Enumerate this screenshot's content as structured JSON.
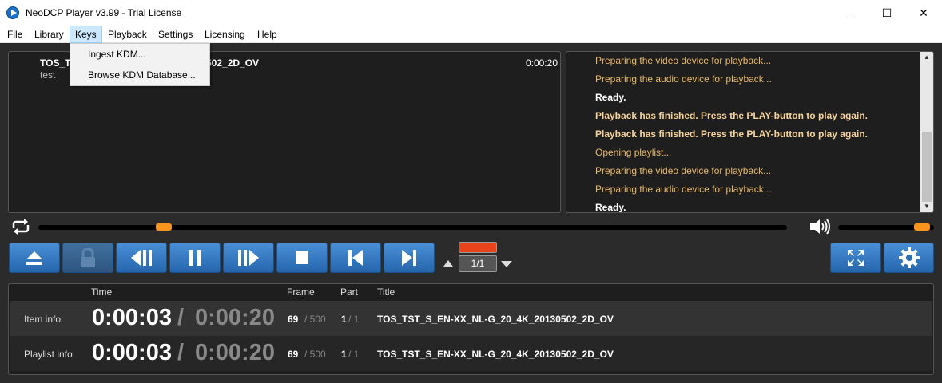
{
  "window": {
    "title": "NeoDCP Player v3.99 - Trial License",
    "minimize": "—",
    "maximize": "☐",
    "close": "✕"
  },
  "menu": {
    "items": [
      "File",
      "Library",
      "Keys",
      "Playback",
      "Settings",
      "Licensing",
      "Help"
    ],
    "active": "Keys"
  },
  "keys_menu": {
    "items": [
      "Ingest KDM...",
      "Browse KDM Database..."
    ]
  },
  "playlist": {
    "item_title_left": "TOS_TS",
    "item_title_right": "502_2D_OV",
    "item_subtitle": "test",
    "item_duration": "0:00:20"
  },
  "log": {
    "lines": [
      {
        "text": "Preparing the video device for playback...",
        "style": "normal"
      },
      {
        "text": "Preparing the audio device for playback...",
        "style": "normal"
      },
      {
        "text": "Ready.",
        "style": "ready"
      },
      {
        "text": "Playback has finished. Press the PLAY-button to play again.",
        "style": "warn"
      },
      {
        "text": "Playback has finished. Press the PLAY-button to play again.",
        "style": "warn"
      },
      {
        "text": "Opening playlist...",
        "style": "normal"
      },
      {
        "text": "Preparing the video device for playback...",
        "style": "normal"
      },
      {
        "text": "Preparing the audio device for playback...",
        "style": "normal"
      },
      {
        "text": "Ready.",
        "style": "ready"
      }
    ]
  },
  "seek": {
    "progress": 0.16
  },
  "volume": {
    "level": 0.95
  },
  "part_selector": {
    "value": "1/1"
  },
  "info": {
    "headers": {
      "time": "Time",
      "frame": "Frame",
      "part": "Part",
      "title": "Title"
    },
    "item": {
      "label": "Item info:",
      "time_current": "0:00:03",
      "time_sep": "/",
      "time_total": "0:00:20",
      "frame_current": "69",
      "frame_total": "/ 500",
      "part_current": "1",
      "part_total": "/ 1",
      "title": "TOS_TST_S_EN-XX_NL-G_20_4K_20130502_2D_OV"
    },
    "playlist": {
      "label": "Playlist info:",
      "time_current": "0:00:03",
      "time_sep": "/",
      "time_total": "0:00:20",
      "frame_current": "69",
      "frame_total": "/ 500",
      "part_current": "1",
      "part_total": "/ 1",
      "title": "TOS_TST_S_EN-XX_NL-G_20_4K_20130502_2D_OV"
    }
  },
  "colors": {
    "accent": "#2f7ac8",
    "handle": "#f7941d",
    "part_indicator": "#e8431b"
  }
}
